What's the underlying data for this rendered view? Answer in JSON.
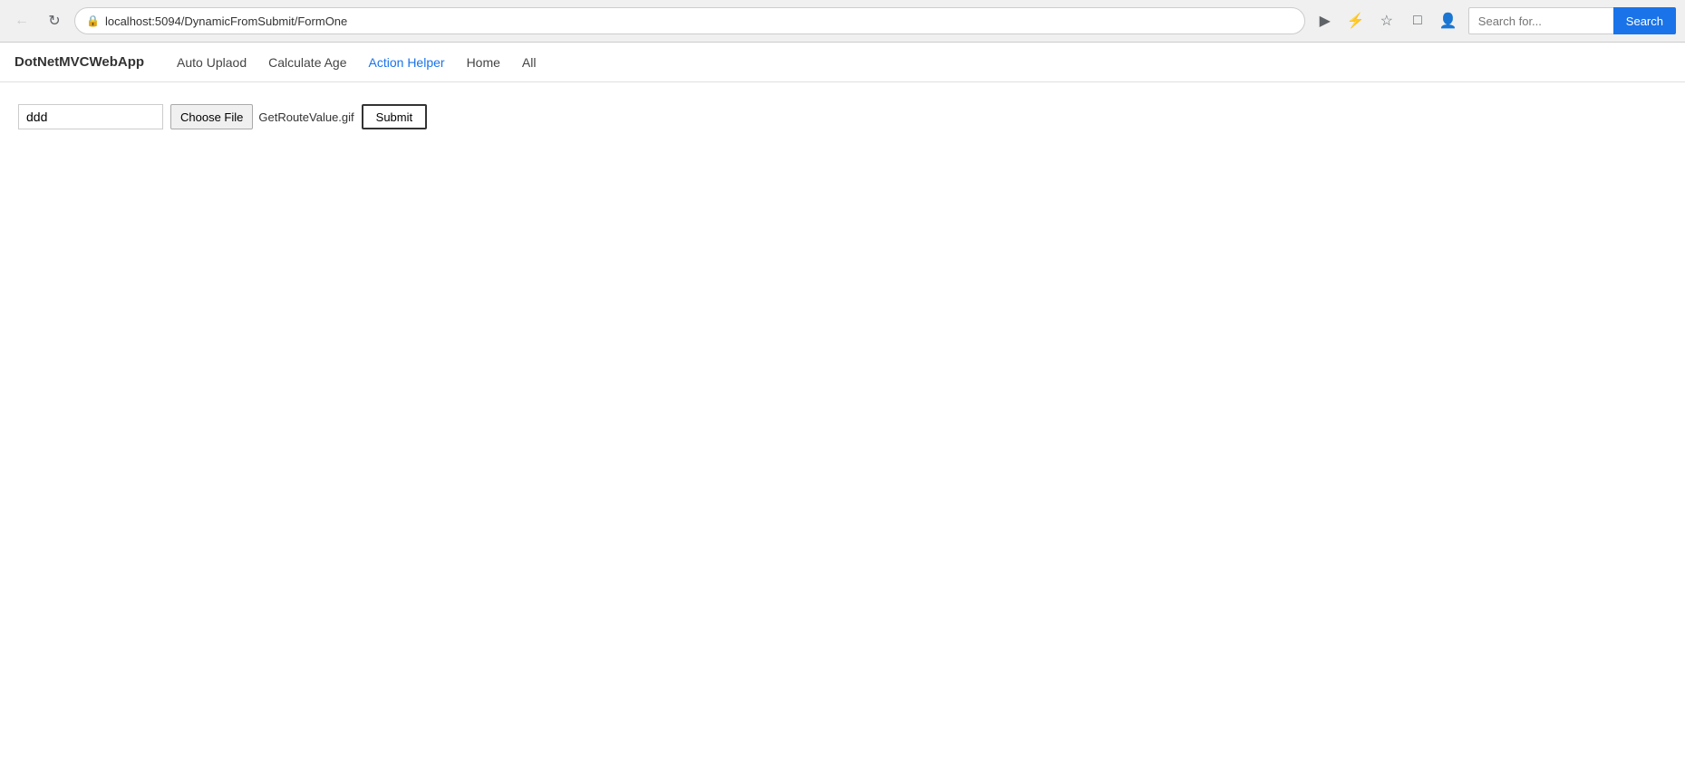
{
  "browser": {
    "url": "localhost:5094/DynamicFromSubmit/FormOne",
    "search_placeholder": "Search for...",
    "search_button_label": "Search"
  },
  "nav": {
    "brand": "DotNetMVCWebApp",
    "links": [
      {
        "label": "Auto Uplaod",
        "href": "#"
      },
      {
        "label": "Calculate Age",
        "href": "#"
      },
      {
        "label": "Action Helper",
        "href": "#",
        "active": true
      },
      {
        "label": "Home",
        "href": "#"
      },
      {
        "label": "All",
        "href": "#"
      }
    ]
  },
  "form": {
    "text_value": "ddd",
    "choose_file_label": "Choose File",
    "file_name": "GetRouteValue.gif",
    "submit_label": "Submit"
  }
}
